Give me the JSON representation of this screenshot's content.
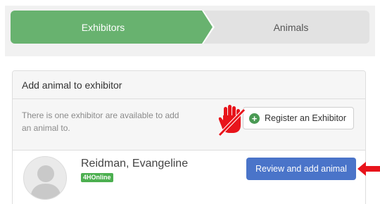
{
  "steps": [
    {
      "label": "Exhibitors",
      "state": "active"
    },
    {
      "label": "Animals",
      "state": "inactive"
    }
  ],
  "panel": {
    "title": "Add animal to exhibitor",
    "info_text": "There is one exhibitor are available to add an animal to.",
    "register_button": {
      "label": "Register an Exhibitor",
      "icon": "plus-circle-icon"
    }
  },
  "exhibitor": {
    "name": "Reidman, Evangeline",
    "badge": "4HOnline",
    "action_label": "Review and add animal"
  },
  "annotations": {
    "hand_icon": "hand-stop-crossed-icon",
    "arrow_icon": "left-arrow-icon",
    "color": "#e8141b"
  },
  "colors": {
    "step_active": "#68b26f",
    "review_button": "#4a74c9",
    "badge": "#4caf50"
  }
}
